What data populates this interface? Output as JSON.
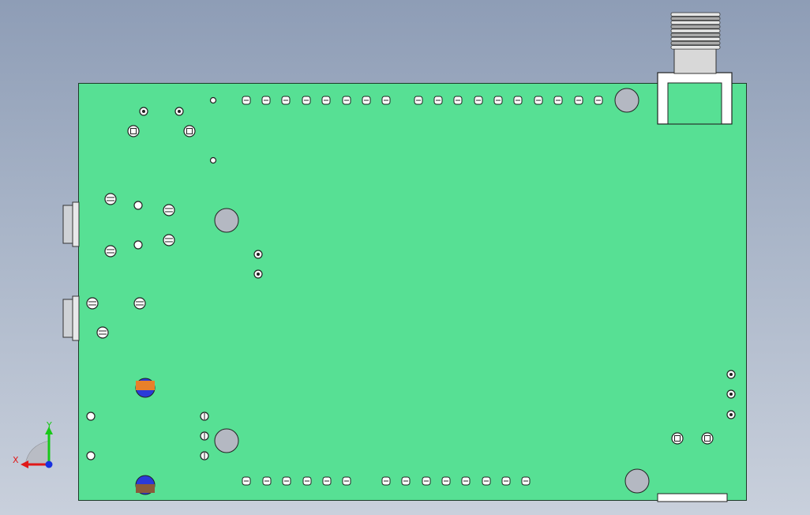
{
  "window": {
    "title": ""
  },
  "viewport": {
    "background_top": "#8e9db6",
    "background_bottom": "#c9d0dc",
    "board_color": "#57e094",
    "board_outline": "#1d3a28",
    "hole_color": "#b4b8c2",
    "connector_fill": "#ffffff",
    "cap_colors": {
      "orange": "#e8802a",
      "blue": "#2a3ad8",
      "brown": "#8a5a3a"
    }
  },
  "triad": {
    "x_label": "X",
    "y_label": "Y",
    "x_color": "#e01818",
    "y_color": "#18c818",
    "z_color": "#1830e0"
  },
  "components": {
    "top_header_count": 18,
    "bottom_header_count": 14,
    "mounting_holes": 4,
    "sma_connector": "sma-connector",
    "audio_jacks": 2
  }
}
